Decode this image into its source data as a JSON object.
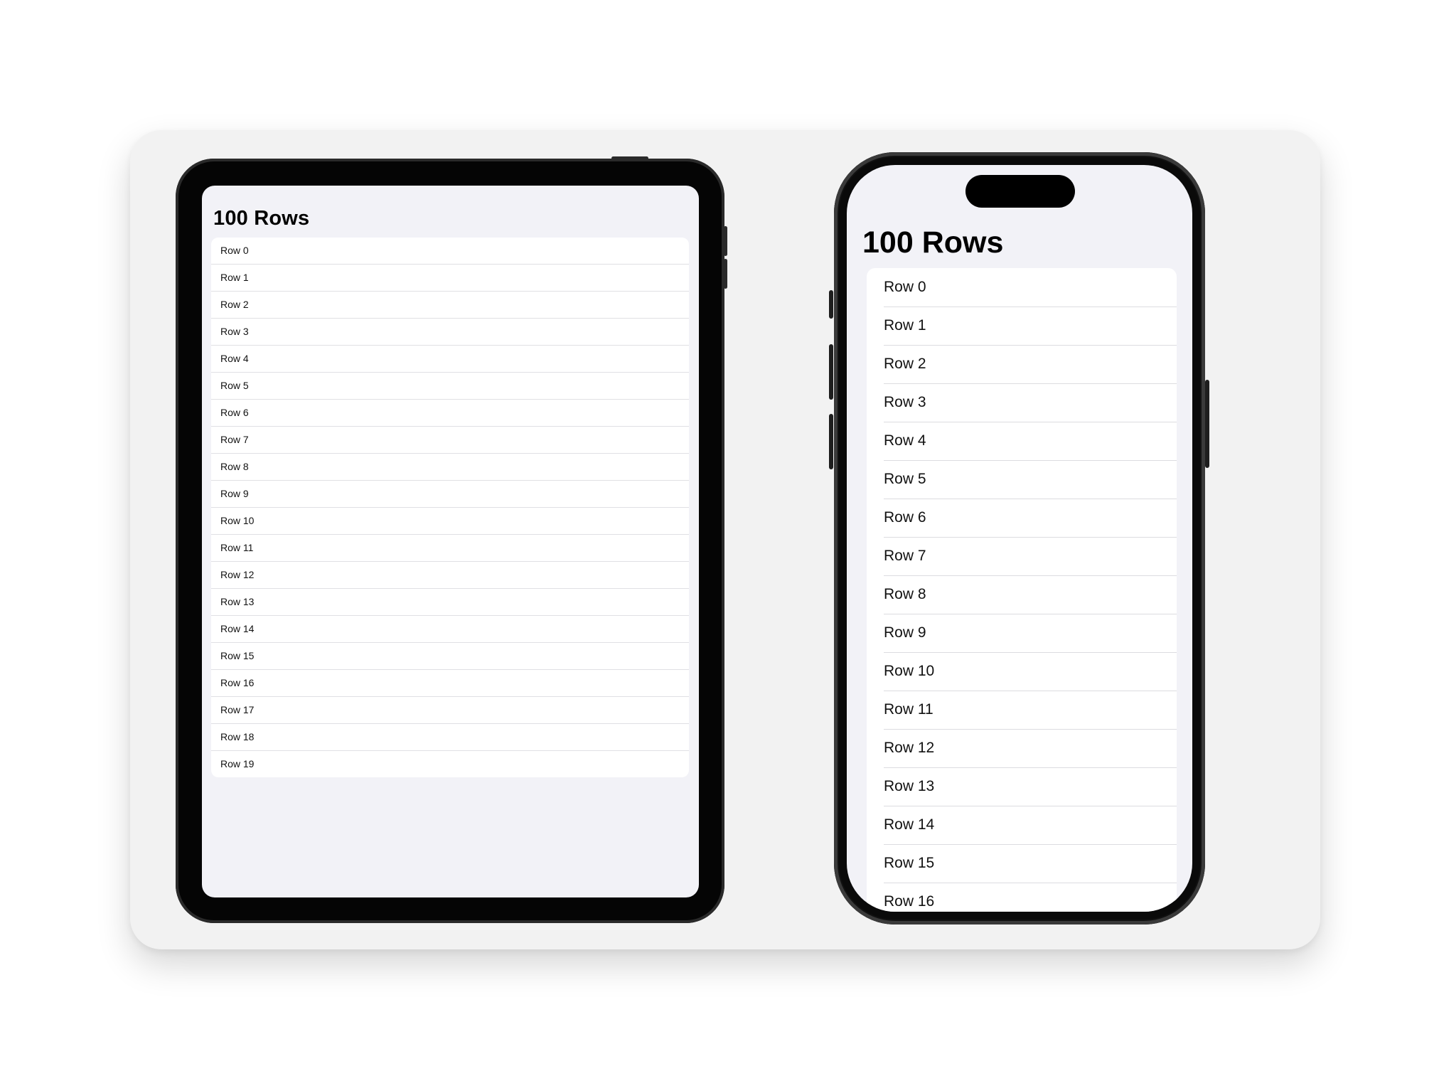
{
  "ipad": {
    "title": "100 Rows",
    "rows": [
      "Row 0",
      "Row 1",
      "Row 2",
      "Row 3",
      "Row 4",
      "Row 5",
      "Row 6",
      "Row 7",
      "Row 8",
      "Row 9",
      "Row 10",
      "Row 11",
      "Row 12",
      "Row 13",
      "Row 14",
      "Row 15",
      "Row 16",
      "Row 17",
      "Row 18",
      "Row 19"
    ]
  },
  "iphone": {
    "title": "100 Rows",
    "rows": [
      "Row 0",
      "Row 1",
      "Row 2",
      "Row 3",
      "Row 4",
      "Row 5",
      "Row 6",
      "Row 7",
      "Row 8",
      "Row 9",
      "Row 10",
      "Row 11",
      "Row 12",
      "Row 13",
      "Row 14",
      "Row 15",
      "Row 16"
    ]
  },
  "colors": {
    "stage_background": "#f2f2f2",
    "screen_background": "#f2f2f7",
    "cell_background": "#ffffff",
    "device_frame": "#050505"
  }
}
